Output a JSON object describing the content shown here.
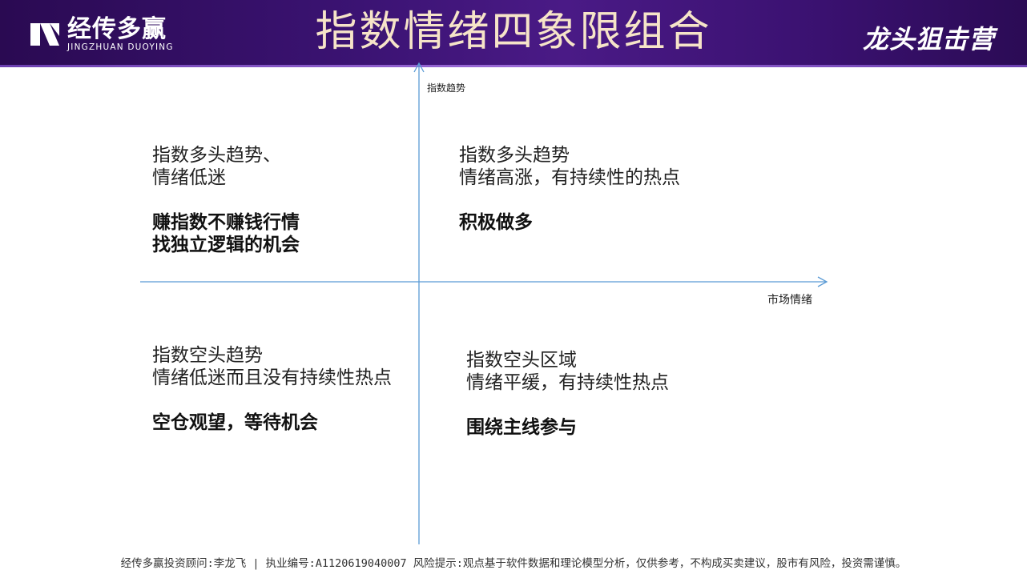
{
  "header": {
    "logo_left_cn": "经传多赢",
    "logo_left_en": "JINGZHUAN DUOYING",
    "title": "指数情绪四象限组合",
    "logo_right": "龙头狙击营"
  },
  "axes": {
    "y_label": "指数趋势",
    "x_label": "市场情绪"
  },
  "quadrants": {
    "top_left": {
      "line1": "指数多头趋势、",
      "line2": "情绪低迷",
      "action1": "赚指数不赚钱行情",
      "action2": "找独立逻辑的机会"
    },
    "top_right": {
      "line1": "指数多头趋势",
      "line2": "情绪高涨，有持续性的热点",
      "action1": "积极做多"
    },
    "bottom_left": {
      "line1": "指数空头趋势",
      "line2": "情绪低迷而且没有持续性热点",
      "action1": "空仓观望，等待机会"
    },
    "bottom_right": {
      "line1": "指数空头区域",
      "line2": "情绪平缓，有持续性热点",
      "action1": "围绕主线参与"
    }
  },
  "footer": {
    "text": "经传多赢投资顾问:李龙飞 | 执业编号:A1120619040007  风险提示:观点基于软件数据和理论模型分析，仅供参考，不构成买卖建议，股市有风险，投资需谨慎。"
  },
  "colors": {
    "header_bg": "#3b1373",
    "title": "#f6e4c8",
    "axis": "#5b9bd5",
    "accent_orange": "#f07a1a"
  }
}
